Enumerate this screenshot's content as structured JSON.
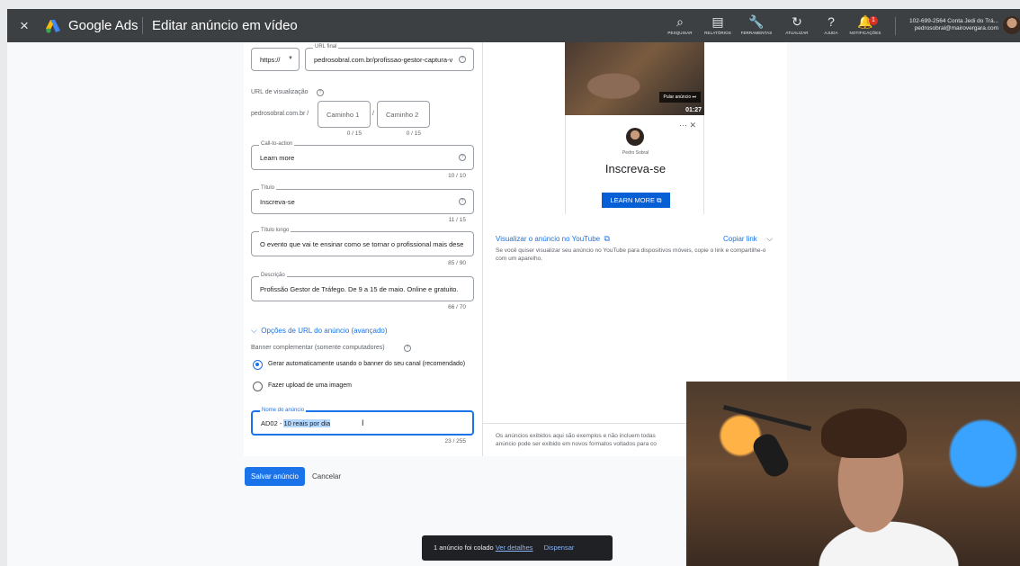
{
  "topbar": {
    "close_glyph": "×",
    "brand": "Google Ads",
    "title": "Editar anúncio em vídeo",
    "tools": [
      {
        "icon": "search-icon",
        "glyph": "⌕",
        "label": "PESQUISAR"
      },
      {
        "icon": "reports-icon",
        "glyph": "▤",
        "label": "RELATÓRIOS"
      },
      {
        "icon": "wrench-icon",
        "glyph": "🔧",
        "label": "FERRAMENTAS"
      },
      {
        "icon": "refresh-icon",
        "glyph": "↻",
        "label": "ATUALIZAR"
      },
      {
        "icon": "help-icon",
        "glyph": "?",
        "label": "AJUDA"
      },
      {
        "icon": "bell-icon",
        "glyph": "🔔",
        "label": "NOTIFICAÇÕES",
        "badge": "1"
      }
    ],
    "account_line1": "102-699-2564 Conta Jedi do Trá...",
    "account_line2": "pedrosobral@mairovergara.com"
  },
  "form": {
    "final_url": {
      "protocol": "https://",
      "legend": "URL final",
      "value": "pedrosobral.com.br/profissao-gestor-captura-v"
    },
    "display_url": {
      "label": "URL de visualização",
      "domain": "pedrosobral.com.br /",
      "path1": "Caminho 1",
      "path2": "Caminho 2",
      "path1_count": "0 / 15",
      "path2_count": "0 / 15",
      "sep": "/"
    },
    "cta": {
      "legend": "Call-to-action",
      "value": "Learn more",
      "count": "10 / 10"
    },
    "title": {
      "legend": "Título",
      "value": "Inscreva-se",
      "count": "11 / 15"
    },
    "long_title": {
      "legend": "Título longo",
      "value": "O evento que vai te ensinar como se tornar o profissional mais dese",
      "count": "85 / 90"
    },
    "description": {
      "legend": "Descrição",
      "value": "Profissão Gestor de Tráfego. De 9 a 15 de maio. Online e gratuito.",
      "count": "66 / 70"
    },
    "url_options": "Opções de URL do anúncio (avançado)",
    "banner": {
      "label": "Banner complementar (somente computadores)",
      "options": [
        {
          "label": "Gerar automaticamente usando o banner do seu canal (recomendado)",
          "selected": true
        },
        {
          "label": "Fazer upload de uma imagem",
          "selected": false
        }
      ]
    },
    "ad_name": {
      "legend": "Nome do anúncio",
      "prefix": "AD02 - ",
      "selected": "10 reais por dia",
      "count": "23 / 255"
    }
  },
  "actions": {
    "save": "Salvar anúncio",
    "cancel": "Cancelar"
  },
  "preview": {
    "skip": "Pular anúncio ⏭",
    "time": "01:27",
    "channel": "Pedro Sobral",
    "headline": "Inscreva-se",
    "cta": "LEARN MORE",
    "view_on_youtube": "Visualizar o anúncio no YouTube",
    "copy_link": "Copiar link",
    "info": "Se você quiser visualizar seu anúncio no YouTube para dispositivos móveis, copie o link e compartilhe-o com um aparelho.",
    "disclaimer_line1": "Os anúncios exibidos aqui são exemplos e não incluem todas",
    "disclaimer_line2": "anúncio pode ser exibido em novos formatos voltados para co"
  },
  "toast": {
    "message": "1 anúncio foi colado",
    "details": "Ver detalhes",
    "dismiss": "Dispensar"
  },
  "colors": {
    "primary": "#1a73e8",
    "topbar": "#3c4043",
    "youtube_cta": "#065fd4"
  }
}
